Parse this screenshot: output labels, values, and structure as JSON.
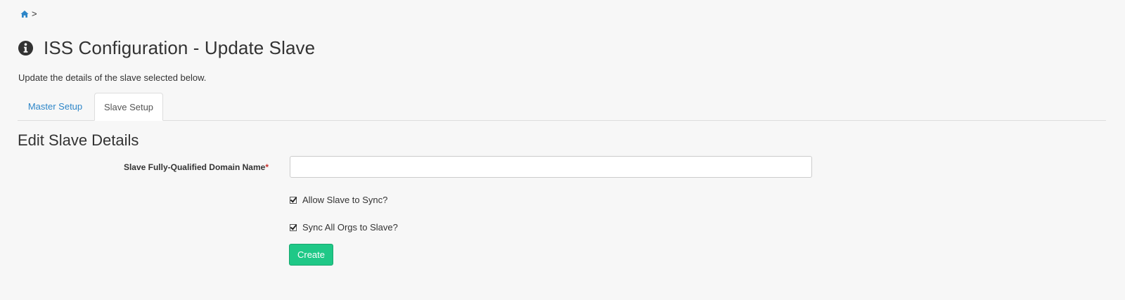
{
  "breadcrumb": {
    "separator": ">"
  },
  "header": {
    "title": "ISS Configuration - Update Slave"
  },
  "subtitle": "Update the details of the slave selected below.",
  "tabs": [
    {
      "label": "Master Setup",
      "active": false
    },
    {
      "label": "Slave Setup",
      "active": true
    }
  ],
  "form": {
    "section_title": "Edit Slave Details",
    "fqdn": {
      "label": "Slave Fully-Qualified Domain Name",
      "required_marker": "*",
      "value": "",
      "placeholder": ""
    },
    "allow_sync": {
      "label": "Allow Slave to Sync?",
      "checked": true
    },
    "sync_all_orgs": {
      "label": "Sync All Orgs to Slave?",
      "checked": true
    },
    "submit_label": "Create"
  },
  "colors": {
    "link": "#2e86c8",
    "accent_button": "#1fc887",
    "required": "#c9302c"
  }
}
